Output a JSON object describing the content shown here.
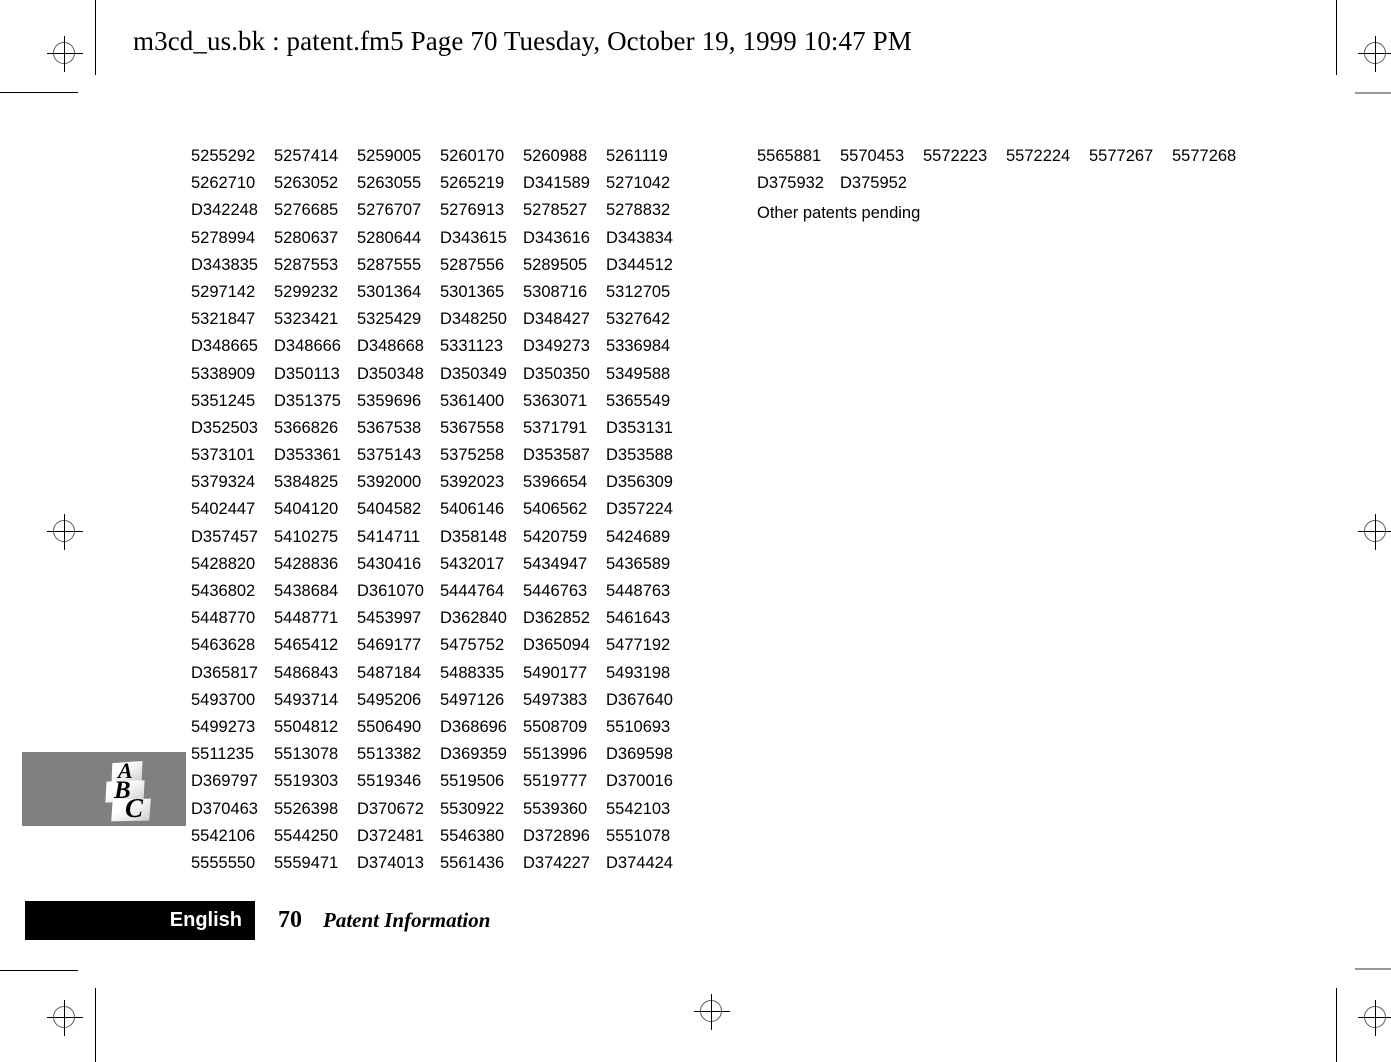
{
  "header": {
    "text": "m3cd_us.bk : patent.fm5  Page 70  Tuesday, October 19, 1999  10:47 PM"
  },
  "patents_left": [
    [
      "5255292",
      "5257414",
      "5259005",
      "5260170",
      "5260988",
      "5261119"
    ],
    [
      "5262710",
      "5263052",
      "5263055",
      "5265219",
      "D341589",
      "5271042"
    ],
    [
      "D342248",
      "5276685",
      "5276707",
      "5276913",
      "5278527",
      "5278832"
    ],
    [
      "5278994",
      "5280637",
      "5280644",
      "D343615",
      "D343616",
      "D343834"
    ],
    [
      "D343835",
      "5287553",
      "5287555",
      "5287556",
      "5289505",
      "D344512"
    ],
    [
      "5297142",
      "5299232",
      "5301364",
      "5301365",
      "5308716",
      "5312705"
    ],
    [
      "5321847",
      "5323421",
      "5325429",
      "D348250",
      "D348427",
      "5327642"
    ],
    [
      "D348665",
      "D348666",
      "D348668",
      "5331123",
      "D349273",
      "5336984"
    ],
    [
      "5338909",
      "D350113",
      "D350348",
      "D350349",
      "D350350",
      "5349588"
    ],
    [
      "5351245",
      "D351375",
      "5359696",
      "5361400",
      "5363071",
      "5365549"
    ],
    [
      "D352503",
      "5366826",
      "5367538",
      "5367558",
      "5371791",
      "D353131"
    ],
    [
      "5373101",
      "D353361",
      "5375143",
      "5375258",
      "D353587",
      "D353588"
    ],
    [
      "5379324",
      "5384825",
      "5392000",
      "5392023",
      "5396654",
      "D356309"
    ],
    [
      "5402447",
      "5404120",
      "5404582",
      "5406146",
      "5406562",
      "D357224"
    ],
    [
      "D357457",
      "5410275",
      "5414711",
      "D358148",
      "5420759",
      "5424689"
    ],
    [
      "5428820",
      "5428836",
      "5430416",
      "5432017",
      "5434947",
      "5436589"
    ],
    [
      "5436802",
      "5438684",
      "D361070",
      "5444764",
      "5446763",
      "5448763"
    ],
    [
      "5448770",
      "5448771",
      "5453997",
      "D362840",
      "D362852",
      "5461643"
    ],
    [
      "5463628",
      "5465412",
      "5469177",
      "5475752",
      "D365094",
      "5477192"
    ],
    [
      "D365817",
      "5486843",
      "5487184",
      "5488335",
      "5490177",
      "5493198"
    ],
    [
      "5493700",
      "5493714",
      "5495206",
      "5497126",
      "5497383",
      "D367640"
    ],
    [
      "5499273",
      "5504812",
      "5506490",
      "D368696",
      "5508709",
      "5510693"
    ],
    [
      "5511235",
      "5513078",
      "5513382",
      "D369359",
      "5513996",
      "D369598"
    ],
    [
      "D369797",
      "5519303",
      "5519346",
      "5519506",
      "5519777",
      "D370016"
    ],
    [
      "D370463",
      "5526398",
      "D370672",
      "5530922",
      "5539360",
      "5542103"
    ],
    [
      "5542106",
      "5544250",
      "D372481",
      "5546380",
      "D372896",
      "5551078"
    ],
    [
      "5555550",
      "5559471",
      "D374013",
      "5561436",
      "D374227",
      "D374424"
    ]
  ],
  "patents_right": [
    [
      "5565881",
      "5570453",
      "5572223",
      "5572224",
      "5577267",
      "5577268"
    ],
    [
      "D375932",
      "D375952",
      "",
      "",
      "",
      ""
    ]
  ],
  "other_patents_note": "Other patents pending",
  "tab_marker": {
    "letter_a": "A",
    "letter_b": "B",
    "letter_c": "C"
  },
  "footer": {
    "language": "English",
    "page_number": "70",
    "section_title": "Patent Information"
  },
  "colors": {
    "tab_background": "#808080",
    "footer_bar": "#000000",
    "text": "#000000",
    "page_background": "#ffffff"
  }
}
